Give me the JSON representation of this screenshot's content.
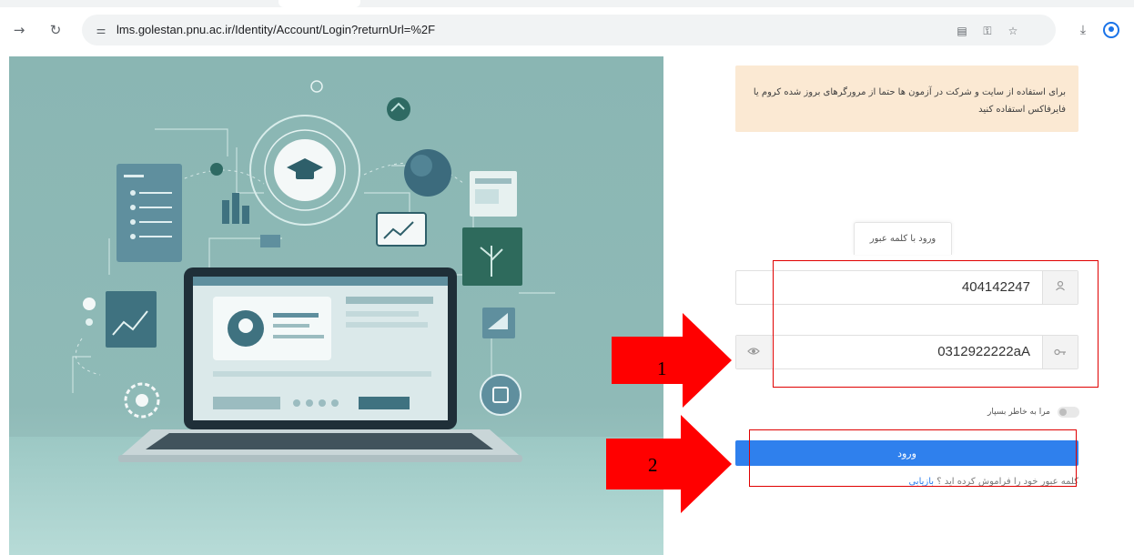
{
  "browser": {
    "url": "lms.golestan.pnu.ac.ir/Identity/Account/Login?returnUrl=%2F",
    "icons": [
      "forward-icon",
      "reload-icon",
      "site-info-icon",
      "translate-icon",
      "password-key-icon",
      "star-icon",
      "download-icon",
      "profile-icon"
    ]
  },
  "alert": {
    "text": "برای استفاده از سایت و شرکت در آزمون ها حتما از مرورگرهای بروز شده کروم یا فایرفاکس استفاده کنید"
  },
  "tabs": {
    "password_login": "ورود با کلمه عبور"
  },
  "form": {
    "username_value": "404142247",
    "password_value": "0312922222aA",
    "remember_label": "مرا به خاطر بسپار",
    "login_button": "ورود",
    "forgot_prefix": "کلمه عبور خود را فراموش کرده اید ؟",
    "forgot_link": "بازیابی"
  },
  "annotations": {
    "arrow_1_label": "1",
    "arrow_2_label": "2",
    "color": "#ff0000"
  },
  "colors": {
    "primary": "#2f80ed",
    "alert_bg": "#fbe9d3",
    "illustration_bg": "#8fbab7"
  }
}
